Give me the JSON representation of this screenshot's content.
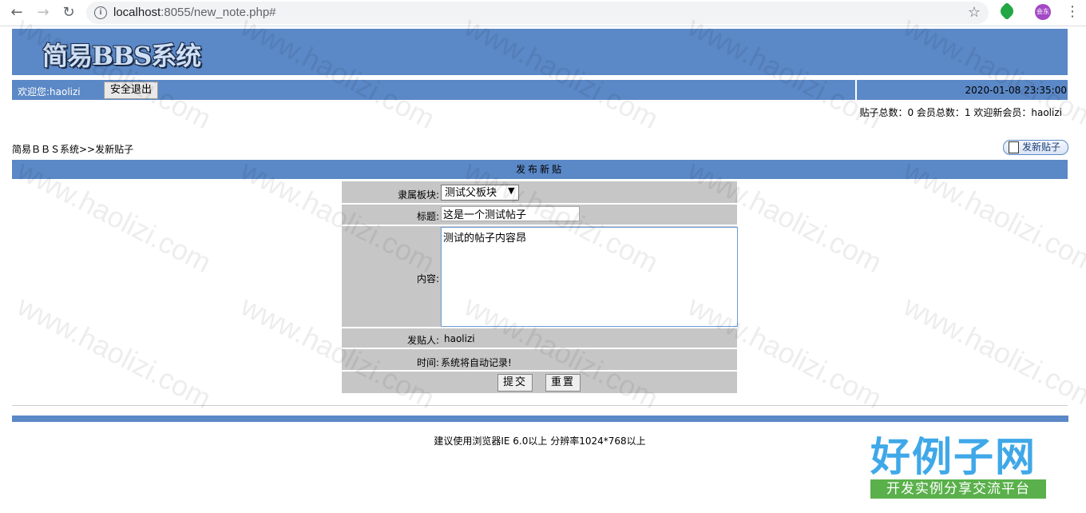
{
  "browser": {
    "url_host": "localhost",
    "url_rest": ":8055/new_note.php#",
    "avatar_text": "会东"
  },
  "header": {
    "logo": "简易BBS系统",
    "welcome": "欢迎您:haolizi",
    "logout_label": "安全退出",
    "datetime": "2020-01-08 23:35:00",
    "stats": "贴子总数：0  会员总数：1  欢迎新会员：haolizi"
  },
  "breadcrumb": "简易ＢＢＳ系统>>发新贴子",
  "new_post_label": "发新贴子",
  "form": {
    "title": "发布新贴",
    "board_label": "隶属板块:",
    "board_value": "测试父板块",
    "subject_label": "标题:",
    "subject_value": "这是一个测试帖子",
    "content_label": "内容:",
    "content_value": "测试的帖子内容昂",
    "poster_label": "发贴人:",
    "poster_value": "haolizi",
    "time_label": "时间:",
    "time_value": "系统将自动记录!",
    "submit_label": "提交",
    "reset_label": "重置"
  },
  "footer": {
    "note": "建议使用浏览器IE 6.0以上 分辨率1024*768以上"
  },
  "watermark": {
    "text": "www.haolizi.com",
    "brand_big": "好例子网",
    "brand_small": "开发实例分享交流平台"
  },
  "colors": {
    "accent": "#5b88c6",
    "form_bg": "#c6c6c6"
  }
}
